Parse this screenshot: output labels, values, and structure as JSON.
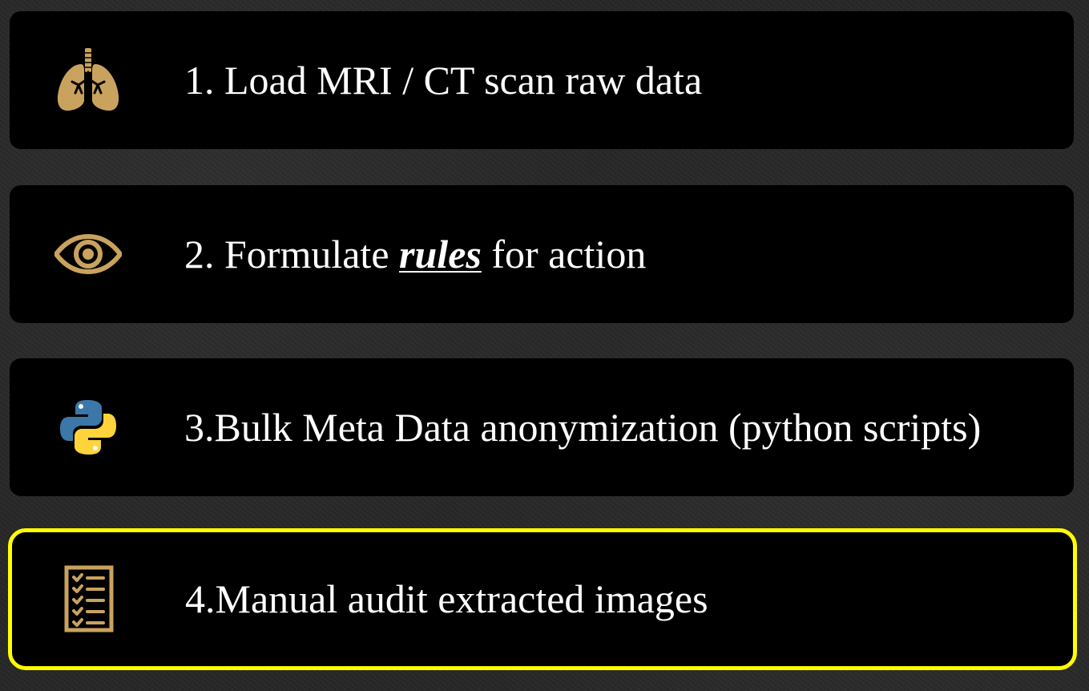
{
  "colors": {
    "background": "#262626",
    "card": "#000000",
    "text": "#ffffff",
    "icon_gold": "#c9a35d",
    "highlight_border": "#ffff00",
    "python_blue": "#3b77a8",
    "python_yellow": "#ffd43b"
  },
  "steps": [
    {
      "icon": "lungs-icon",
      "text": "1. Load MRI / CT scan raw data"
    },
    {
      "icon": "eye-icon",
      "text_before": "2. Formulate ",
      "text_emphasis": "rules",
      "text_after": " for action"
    },
    {
      "icon": "python-logo-icon",
      "text": "3.Bulk Meta Data anonymization (python scripts)"
    },
    {
      "icon": "checklist-icon",
      "text": "4.Manual audit extracted images",
      "highlighted": true
    }
  ]
}
